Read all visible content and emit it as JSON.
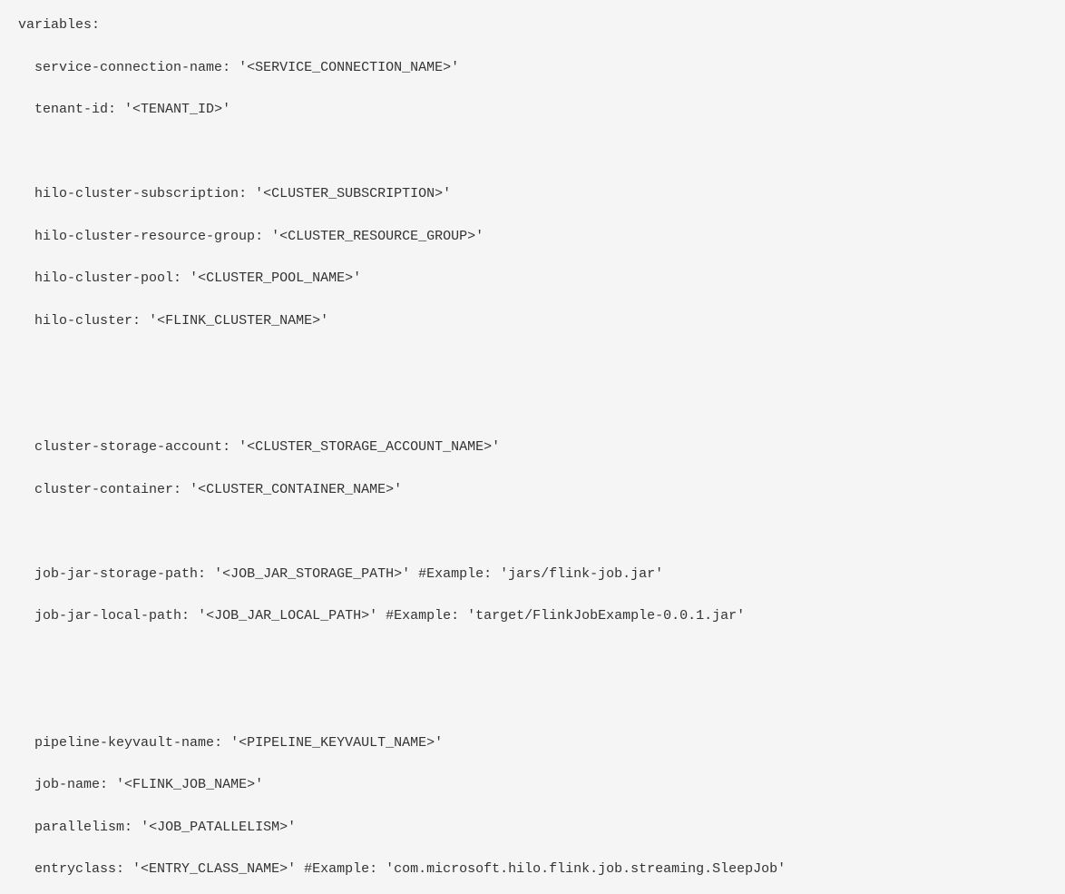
{
  "code": {
    "header": "variables:",
    "lines": [
      {
        "indent": 1,
        "key": "service-connection-name",
        "value": "'<SERVICE_CONNECTION_NAME>'",
        "comment": ""
      },
      {
        "indent": 1,
        "key": "tenant-id",
        "value": "'<TENANT_ID>'",
        "comment": ""
      },
      {
        "blank": true
      },
      {
        "indent": 1,
        "key": "hilo-cluster-subscription",
        "value": "'<CLUSTER_SUBSCRIPTION>'",
        "comment": ""
      },
      {
        "indent": 1,
        "key": "hilo-cluster-resource-group",
        "value": "'<CLUSTER_RESOURCE_GROUP>'",
        "comment": ""
      },
      {
        "indent": 1,
        "key": "hilo-cluster-pool",
        "value": "'<CLUSTER_POOL_NAME>'",
        "comment": ""
      },
      {
        "indent": 1,
        "key": "hilo-cluster",
        "value": "'<FLINK_CLUSTER_NAME>'",
        "comment": ""
      },
      {
        "blank": true
      },
      {
        "blank": true
      },
      {
        "indent": 1,
        "key": "cluster-storage-account",
        "value": "'<CLUSTER_STORAGE_ACCOUNT_NAME>'",
        "comment": ""
      },
      {
        "indent": 1,
        "key": "cluster-container",
        "value": "'<CLUSTER_CONTAINER_NAME>'",
        "comment": ""
      },
      {
        "blank": true
      },
      {
        "indent": 1,
        "key": "job-jar-storage-path",
        "value": "'<JOB_JAR_STORAGE_PATH>'",
        "comment": " #Example: 'jars/flink-job.jar'"
      },
      {
        "indent": 1,
        "key": "job-jar-local-path",
        "value": "'<JOB_JAR_LOCAL_PATH>'",
        "comment": " #Example: 'target/FlinkJobExample-0.0.1.jar'"
      },
      {
        "blank": true
      },
      {
        "blank": true
      },
      {
        "indent": 1,
        "key": "pipeline-keyvault-name",
        "value": "'<PIPELINE_KEYVAULT_NAME>'",
        "comment": ""
      },
      {
        "indent": 1,
        "key": "job-name",
        "value": "'<FLINK_JOB_NAME>'",
        "comment": ""
      },
      {
        "indent": 1,
        "key": "parallelism",
        "value": "'<JOB_PATALLELISM>'",
        "comment": ""
      },
      {
        "indent": 1,
        "key": "entryclass",
        "value": "'<ENTRY_CLASS_NAME>'",
        "comment": " #Example: 'com.microsoft.hilo.flink.job.streaming.SleepJob'"
      }
    ]
  }
}
